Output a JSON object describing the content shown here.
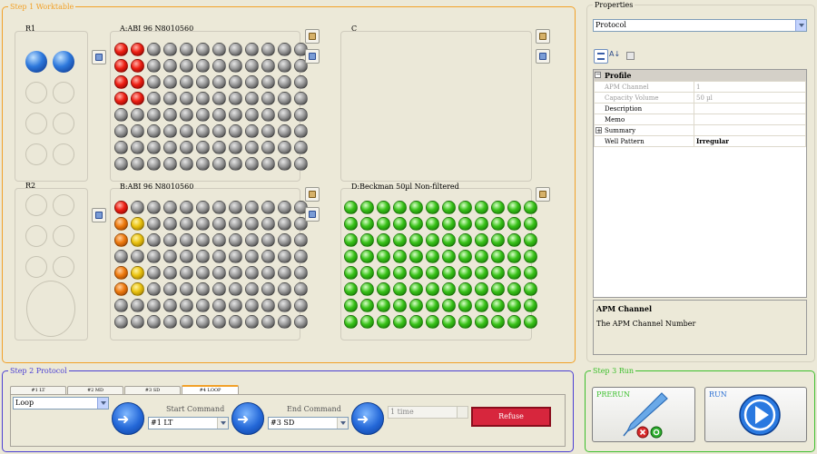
{
  "step1": {
    "title": "Step 1 Worktable",
    "racks": {
      "r1_label": "R1",
      "r2_label": "R2"
    },
    "plates": {
      "a_label": "A:ABI 96 N8010560",
      "b_label": "B:ABI 96 N8010560",
      "c_label": "C",
      "d_label": "D:Beckman 50µl Non-filtered"
    },
    "well_colors": {
      "gray": "#8f8f8f",
      "red": "#ee1f13",
      "orange": "#ee7a0e",
      "yellow": "#eac20e",
      "green": "#39c219",
      "blue": "#2d78dc"
    },
    "plate_a_wells": [
      [
        "red",
        "red",
        "gray",
        "gray",
        "gray",
        "gray",
        "gray",
        "gray",
        "gray",
        "gray",
        "gray",
        "gray"
      ],
      [
        "red",
        "red",
        "gray",
        "gray",
        "gray",
        "gray",
        "gray",
        "gray",
        "gray",
        "gray",
        "gray",
        "gray"
      ],
      [
        "red",
        "red",
        "gray",
        "gray",
        "gray",
        "gray",
        "gray",
        "gray",
        "gray",
        "gray",
        "gray",
        "gray"
      ],
      [
        "red",
        "red",
        "gray",
        "gray",
        "gray",
        "gray",
        "gray",
        "gray",
        "gray",
        "gray",
        "gray",
        "gray"
      ],
      [
        "gray",
        "gray",
        "gray",
        "gray",
        "gray",
        "gray",
        "gray",
        "gray",
        "gray",
        "gray",
        "gray",
        "gray"
      ],
      [
        "gray",
        "gray",
        "gray",
        "gray",
        "gray",
        "gray",
        "gray",
        "gray",
        "gray",
        "gray",
        "gray",
        "gray"
      ],
      [
        "gray",
        "gray",
        "gray",
        "gray",
        "gray",
        "gray",
        "gray",
        "gray",
        "gray",
        "gray",
        "gray",
        "gray"
      ],
      [
        "gray",
        "gray",
        "gray",
        "gray",
        "gray",
        "gray",
        "gray",
        "gray",
        "gray",
        "gray",
        "gray",
        "gray"
      ]
    ],
    "plate_b_wells": [
      [
        "red",
        "gray",
        "gray",
        "gray",
        "gray",
        "gray",
        "gray",
        "gray",
        "gray",
        "gray",
        "gray",
        "gray"
      ],
      [
        "orange",
        "yellow",
        "gray",
        "gray",
        "gray",
        "gray",
        "gray",
        "gray",
        "gray",
        "gray",
        "gray",
        "gray"
      ],
      [
        "orange",
        "yellow",
        "gray",
        "gray",
        "gray",
        "gray",
        "gray",
        "gray",
        "gray",
        "gray",
        "gray",
        "gray"
      ],
      [
        "gray",
        "gray",
        "gray",
        "gray",
        "gray",
        "gray",
        "gray",
        "gray",
        "gray",
        "gray",
        "gray",
        "gray"
      ],
      [
        "orange",
        "yellow",
        "gray",
        "gray",
        "gray",
        "gray",
        "gray",
        "gray",
        "gray",
        "gray",
        "gray",
        "gray"
      ],
      [
        "orange",
        "yellow",
        "gray",
        "gray",
        "gray",
        "gray",
        "gray",
        "gray",
        "gray",
        "gray",
        "gray",
        "gray"
      ],
      [
        "gray",
        "gray",
        "gray",
        "gray",
        "gray",
        "gray",
        "gray",
        "gray",
        "gray",
        "gray",
        "gray",
        "gray"
      ],
      [
        "gray",
        "gray",
        "gray",
        "gray",
        "gray",
        "gray",
        "gray",
        "gray",
        "gray",
        "gray",
        "gray",
        "gray"
      ]
    ],
    "plate_d_wells": [
      [
        "green",
        "green",
        "green",
        "green",
        "green",
        "green",
        "green",
        "green",
        "green",
        "green",
        "green",
        "green"
      ],
      [
        "green",
        "green",
        "green",
        "green",
        "green",
        "green",
        "green",
        "green",
        "green",
        "green",
        "green",
        "green"
      ],
      [
        "green",
        "green",
        "green",
        "green",
        "green",
        "green",
        "green",
        "green",
        "green",
        "green",
        "green",
        "green"
      ],
      [
        "green",
        "green",
        "green",
        "green",
        "green",
        "green",
        "green",
        "green",
        "green",
        "green",
        "green",
        "green"
      ],
      [
        "green",
        "green",
        "green",
        "green",
        "green",
        "green",
        "green",
        "green",
        "green",
        "green",
        "green",
        "green"
      ],
      [
        "green",
        "green",
        "green",
        "green",
        "green",
        "green",
        "green",
        "green",
        "green",
        "green",
        "green",
        "green"
      ],
      [
        "green",
        "green",
        "green",
        "green",
        "green",
        "green",
        "green",
        "green",
        "green",
        "green",
        "green",
        "green"
      ],
      [
        "green",
        "green",
        "green",
        "green",
        "green",
        "green",
        "green",
        "green",
        "green",
        "green",
        "green",
        "green"
      ]
    ]
  },
  "properties": {
    "title": "Properties",
    "selector_value": "Protocol",
    "toolbar_icons": [
      "categorized-icon",
      "alphabetical-sort-icon",
      "property-pages-icon"
    ],
    "category": "Profile",
    "rows": [
      {
        "name": "APM Channel",
        "value": "1",
        "disabled": true,
        "expandable": false,
        "bold": false
      },
      {
        "name": "Capacity Volume",
        "value": "50 µl",
        "disabled": true,
        "expandable": false,
        "bold": false
      },
      {
        "name": "Description",
        "value": "",
        "disabled": false,
        "expandable": false,
        "bold": false
      },
      {
        "name": "Memo",
        "value": "",
        "disabled": false,
        "expandable": false,
        "bold": false
      },
      {
        "name": "Summary",
        "value": "",
        "disabled": false,
        "expandable": true,
        "bold": false
      },
      {
        "name": "Well Pattern",
        "value": "Irregular",
        "disabled": false,
        "expandable": false,
        "bold": true
      }
    ],
    "help_title": "APM Channel",
    "help_text": "The APM Channel Number"
  },
  "step2": {
    "title": "Step 2 Protocol",
    "tabs": [
      "#1 LT",
      "#2 MD",
      "#3 SD",
      "#4 LOOP"
    ],
    "active_tab": 3,
    "command_value": "Loop",
    "start_label": "Start Command",
    "start_value": "#1 LT",
    "end_label": "End Command",
    "end_value": "#3 SD",
    "time_value": "1 time",
    "refuse_label": "Refuse",
    "refuse_color": "#d7263d"
  },
  "step3": {
    "title": "Step 3 Run",
    "prerun_label": "PRERUN",
    "run_label": "RUN"
  }
}
